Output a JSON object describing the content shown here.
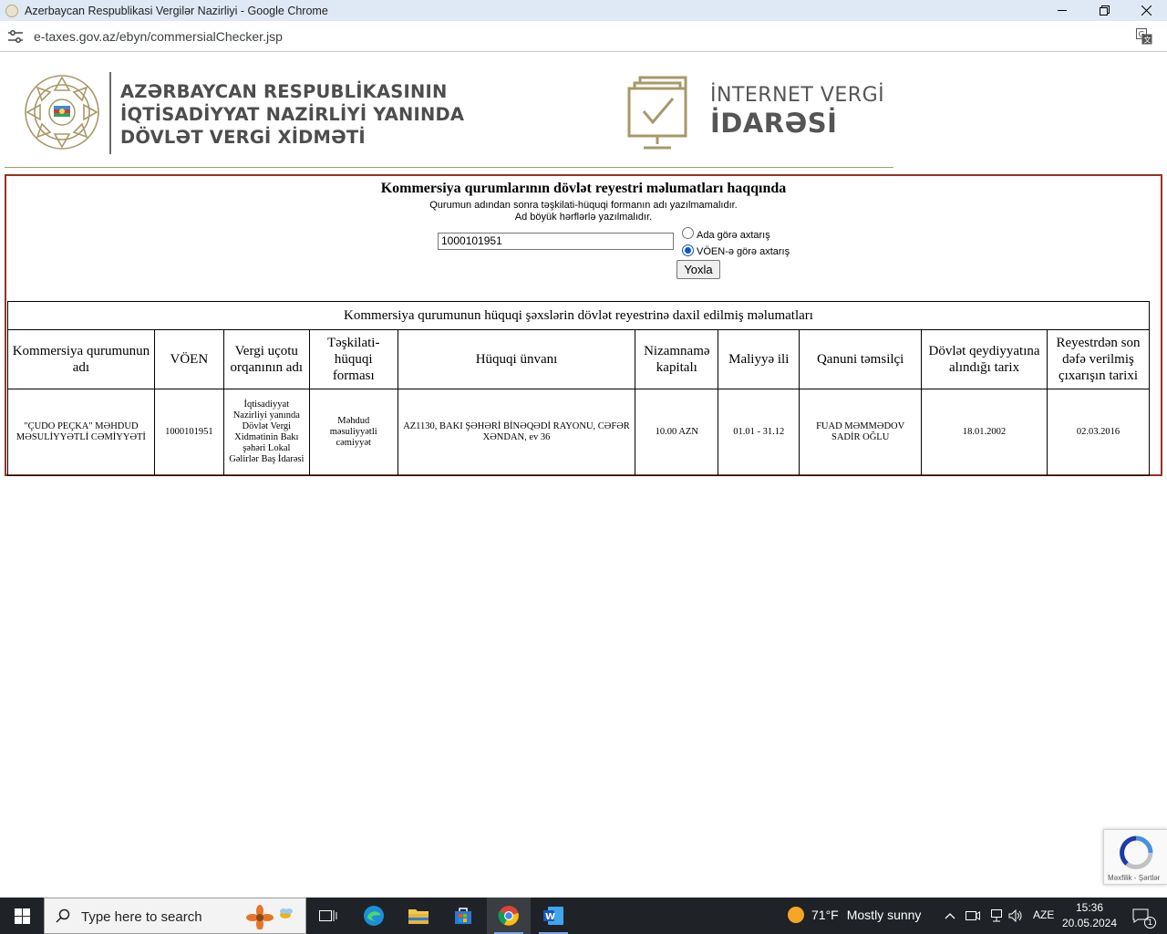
{
  "browser": {
    "window_title": "Azerbaycan Respublikasi Vergilər Nazirliyi - Google Chrome",
    "url": "e-taxes.gov.az/ebyn/commersialChecker.jsp"
  },
  "header": {
    "ministry_lines": [
      "AZƏRBAYCAN RESPUBLİKASININ",
      "İQTİSADİYYAT NAZİRLİYİ YANINDA",
      "DÖVLƏT VERGİ XİDMƏTİ"
    ],
    "ivi_line1": "İNTERNET VERGİ",
    "ivi_line2": "İDARƏSİ"
  },
  "form": {
    "title": "Kommersiya qurumlarının dövlət reyestri məlumatları haqqında",
    "note1": "Qurumun adından sonra təşkilati-hüquqi formanın adı yazılmamalıdır.",
    "note2": "Ad böyük hərflərlə yazılmalıdır.",
    "voen_value": "1000101951",
    "radio_name_label": "Ada görə axtarış",
    "radio_voen_label": "VÖEN-ə görə axtarış",
    "selected_radio": "voen",
    "submit_label": "Yoxla"
  },
  "table": {
    "caption": "Kommersiya qurumunun hüquqi şəxslərin dövlət reyestrinə daxil edilmiş məlumatları",
    "headers": [
      "Kommersiya qurumunun adı",
      "VÖEN",
      "Vergi uçotu orqanının adı",
      "Təşkilati-hüquqi forması",
      "Hüquqi ünvanı",
      "Nizamnamə kapitalı",
      "Maliyyə ili",
      "Qanuni təmsilçi",
      "Dövlət qeydiyyatına alındığı tarix",
      "Reyestrdən son dəfə verilmiş çıxarışın tarixi"
    ],
    "row": [
      "\"ÇUDO PEÇKA\" MƏHDUD MƏSULİYYƏTLİ CƏMİYYƏTİ",
      "1000101951",
      "İqtisadiyyat Nazirliyi yanında Dövlət Vergi Xidmətinin Bakı şəhəri Lokal Gəlirlər Baş İdarəsi",
      "Məhdud məsuliyyətli cəmiyyət",
      "AZ1130, BAKI ŞƏHƏRİ BİNƏQƏDİ RAYONU, CƏFƏR XƏNDAN, ev 36",
      "10.00 AZN",
      "01.01 - 31.12",
      "FUAD MƏMMƏDOV SADİR OĞLU",
      "18.01.2002",
      "02.03.2016"
    ]
  },
  "recaptcha": {
    "text": "Məxfilik - Şərtlər"
  },
  "taskbar": {
    "search_placeholder": "Type here to search",
    "weather_temp": "71°F",
    "weather_text": "Mostly sunny",
    "language": "AZE",
    "time": "15:36",
    "date": "20.05.2024",
    "notification_count": "1"
  },
  "colors": {
    "box_border": "#993322",
    "gold": "#a89868",
    "taskbar": "#1f2226"
  }
}
